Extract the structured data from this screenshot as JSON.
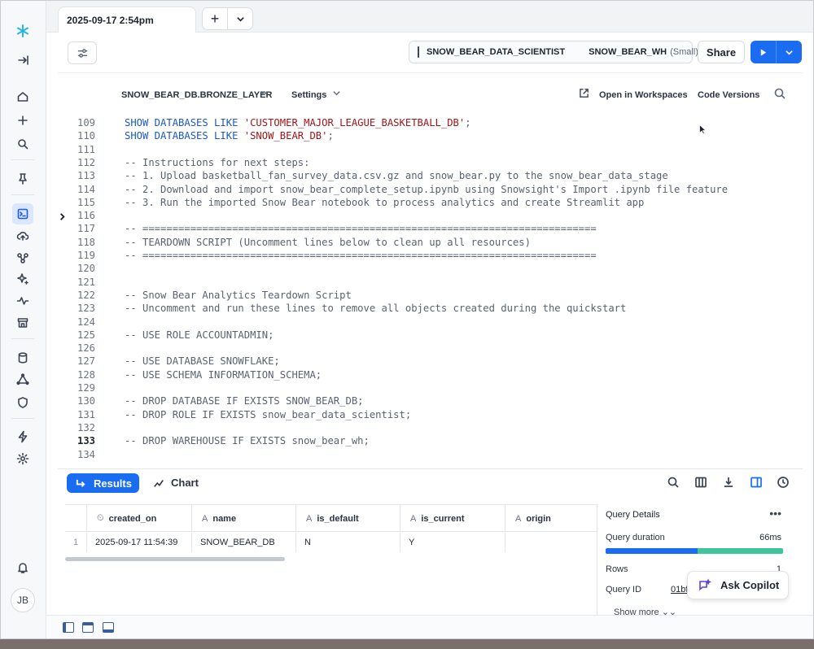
{
  "tab": {
    "title": "2025-09-17 2:54pm",
    "add_label": "+",
    "menu_label": "⌄"
  },
  "toolbar": {
    "role": "SNOW_BEAR_DATA_SCIENTIST",
    "warehouse": "SNOW_BEAR_WH",
    "warehouse_size": "(Small)",
    "share_label": "Share"
  },
  "editor_header": {
    "database": "SNOW_BEAR_DB.BRONZE_LAYER",
    "settings": "Settings",
    "open_workspaces": "Open in Workspaces",
    "code_versions": "Code Versions"
  },
  "code_lines": [
    {
      "n": "109",
      "parts": [
        [
          "kw",
          "SHOW DATABASES LIKE "
        ],
        [
          "str",
          "'CUSTOMER_MAJOR_LEAGUE_BASKETBALL_DB'"
        ],
        [
          "t",
          ";"
        ]
      ]
    },
    {
      "n": "110",
      "parts": [
        [
          "kw",
          "SHOW DATABASES LIKE "
        ],
        [
          "str",
          "'SNOW_BEAR_DB'"
        ],
        [
          "t",
          ";"
        ]
      ]
    },
    {
      "n": "111",
      "parts": []
    },
    {
      "n": "112",
      "parts": [
        [
          "t",
          "-- Instructions for next steps:"
        ]
      ]
    },
    {
      "n": "113",
      "parts": [
        [
          "t",
          "-- 1. Upload basketball_fan_survey_data.csv.gz and snow_bear.py to the snow_bear_data_stage"
        ]
      ]
    },
    {
      "n": "114",
      "parts": [
        [
          "t",
          "-- 2. Download and import snow_bear_complete_setup.ipynb using Snowsight's Import .ipynb file feature"
        ]
      ]
    },
    {
      "n": "115",
      "parts": [
        [
          "t",
          "-- 3. Run the imported Snow Bear notebook to process analytics and create Streamlit app"
        ]
      ]
    },
    {
      "n": "116",
      "parts": []
    },
    {
      "n": "117",
      "parts": [
        [
          "t",
          "-- ============================================================================"
        ]
      ]
    },
    {
      "n": "118",
      "parts": [
        [
          "t",
          "-- TEARDOWN SCRIPT (Uncomment lines below to clean up all resources)"
        ]
      ]
    },
    {
      "n": "119",
      "parts": [
        [
          "t",
          "-- ============================================================================"
        ]
      ]
    },
    {
      "n": "120",
      "parts": []
    },
    {
      "n": "121",
      "parts": []
    },
    {
      "n": "122",
      "parts": [
        [
          "t",
          "-- Snow Bear Analytics Teardown Script"
        ]
      ]
    },
    {
      "n": "123",
      "parts": [
        [
          "t",
          "-- Uncomment and run these lines to remove all objects created during the quickstart"
        ]
      ]
    },
    {
      "n": "124",
      "parts": []
    },
    {
      "n": "125",
      "parts": [
        [
          "t",
          "-- USE ROLE ACCOUNTADMIN;"
        ]
      ]
    },
    {
      "n": "126",
      "parts": []
    },
    {
      "n": "127",
      "parts": [
        [
          "t",
          "-- USE DATABASE SNOWFLAKE;"
        ]
      ]
    },
    {
      "n": "128",
      "parts": [
        [
          "t",
          "-- USE SCHEMA INFORMATION_SCHEMA;"
        ]
      ]
    },
    {
      "n": "129",
      "parts": []
    },
    {
      "n": "130",
      "parts": [
        [
          "t",
          "-- DROP DATABASE IF EXISTS SNOW_BEAR_DB;"
        ]
      ]
    },
    {
      "n": "131",
      "parts": [
        [
          "t",
          "-- DROP ROLE IF EXISTS snow_bear_data_scientist;"
        ]
      ]
    },
    {
      "n": "132",
      "parts": []
    },
    {
      "n": "133",
      "parts": [
        [
          "t",
          "-- DROP WAREHOUSE IF EXISTS snow_bear_wh;"
        ]
      ]
    },
    {
      "n": "134",
      "parts": []
    }
  ],
  "current_line": "133",
  "results": {
    "results_label": "Results",
    "chart_label": "Chart",
    "columns": [
      {
        "type": "⏲",
        "name": "created_on"
      },
      {
        "type": "A",
        "name": "name"
      },
      {
        "type": "A",
        "name": "is_default"
      },
      {
        "type": "A",
        "name": "is_current"
      },
      {
        "type": "A",
        "name": "origin"
      }
    ],
    "rows": [
      {
        "idx": "1",
        "cells": [
          "2025-09-17 11:54:39",
          "SNOW_BEAR_DB",
          "N",
          "Y",
          ""
        ]
      }
    ]
  },
  "query_details": {
    "title": "Query Details",
    "duration_label": "Query duration",
    "duration_value": "66ms",
    "rows_label": "Rows",
    "rows_value": "1",
    "query_id_label": "Query ID",
    "query_id_value": "01bf",
    "show_more": "Show more ⌄⌄",
    "duration_split": 0.52
  },
  "copilot_label": "Ask Copilot",
  "avatar_initials": "JB",
  "colors": {
    "accent": "#1a6cf0",
    "keyword": "#1d59c5",
    "string": "#a31515",
    "duration_bar_secondary": "#3fc59a"
  }
}
